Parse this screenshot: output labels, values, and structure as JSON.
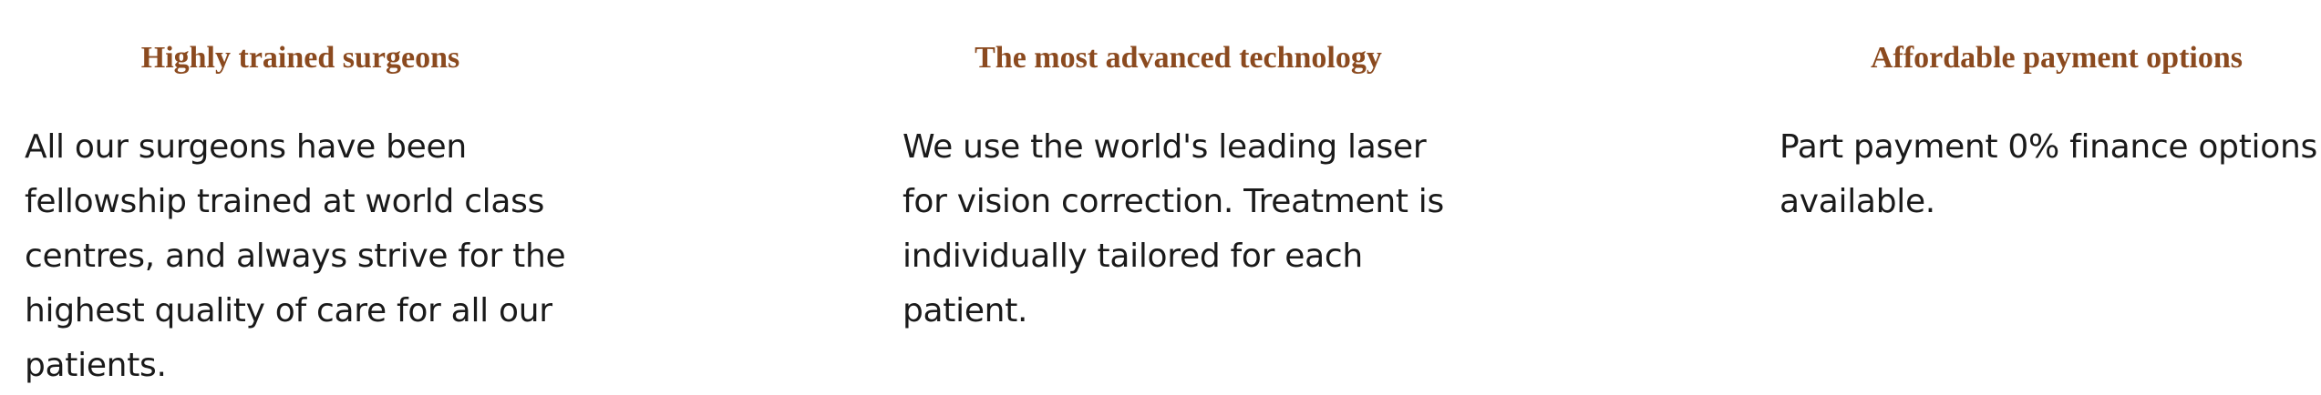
{
  "features": [
    {
      "title": "Highly trained surgeons",
      "description": "All our surgeons have been fellowship trained at world class centres, and always strive for the highest quality of care for all our patients."
    },
    {
      "title": "The most advanced technology",
      "description": "We use the world's leading laser for vision correction. Treatment is individually tailored for each patient."
    },
    {
      "title": "Affordable payment options",
      "description": "Part payment 0% finance options available."
    }
  ],
  "colors": {
    "heading": "#8b4a1f",
    "body_text": "#1a1a1a",
    "background": "#ffffff"
  }
}
